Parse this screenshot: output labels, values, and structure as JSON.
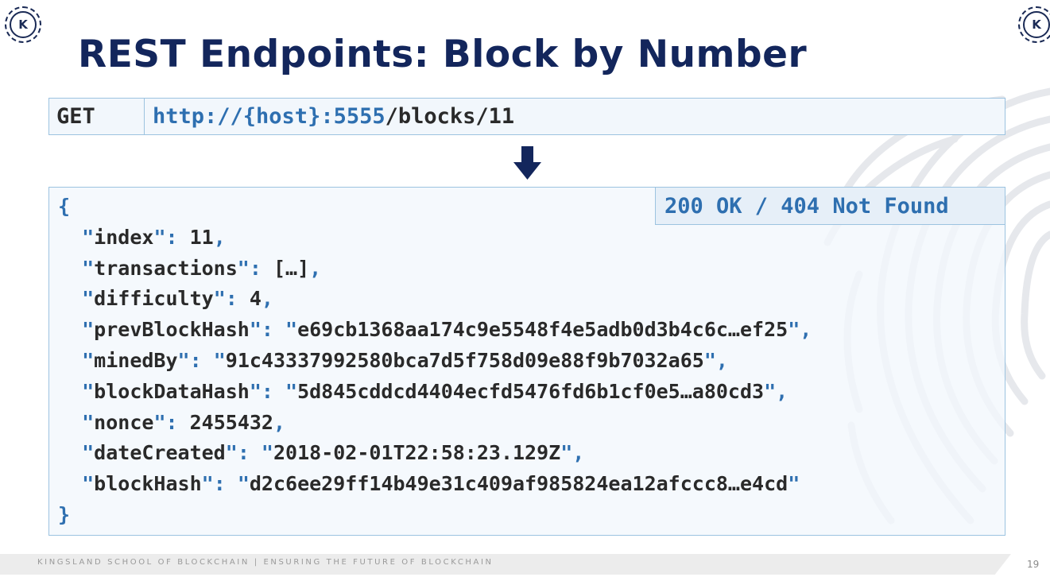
{
  "logos": {
    "letter": "K"
  },
  "slide": {
    "title": "REST Endpoints: Block by Number"
  },
  "request": {
    "method": "GET",
    "url_base": "http://{host}:5555",
    "url_path": "/blocks/11"
  },
  "response": {
    "status": "200 OK / 404 Not Found",
    "open_brace": "{",
    "close_brace": "}",
    "fields": [
      {
        "key": "index",
        "value": "11",
        "quoted": false,
        "comma": true
      },
      {
        "key": "transactions",
        "value": "[…]",
        "quoted": false,
        "comma": true
      },
      {
        "key": "difficulty",
        "value": "4",
        "quoted": false,
        "comma": true
      },
      {
        "key": "prevBlockHash",
        "value": "e69cb1368aa174c9e5548f4e5adb0d3b4c6c…ef25",
        "quoted": true,
        "comma": true
      },
      {
        "key": "minedBy",
        "value": "91c43337992580bca7d5f758d09e88f9b7032a65",
        "quoted": true,
        "comma": true
      },
      {
        "key": "blockDataHash",
        "value": "5d845cddcd4404ecfd5476fd6b1cf0e5…a80cd3",
        "quoted": true,
        "comma": true
      },
      {
        "key": "nonce",
        "value": "2455432",
        "quoted": false,
        "comma": true
      },
      {
        "key": "dateCreated",
        "value": "2018-02-01T22:58:23.129Z",
        "quoted": true,
        "comma": true
      },
      {
        "key": "blockHash",
        "value": "d2c6ee29ff14b49e31c409af985824ea12afccc8…e4cd",
        "quoted": true,
        "comma": false
      }
    ]
  },
  "footer": {
    "text": "KINGSLAND SCHOOL OF BLOCKCHAIN | ENSURING THE FUTURE OF BLOCKCHAIN",
    "page_number": "19"
  },
  "colors": {
    "title": "#13265c",
    "accent": "#2e6fb0",
    "box_border": "#9cc3e0"
  }
}
